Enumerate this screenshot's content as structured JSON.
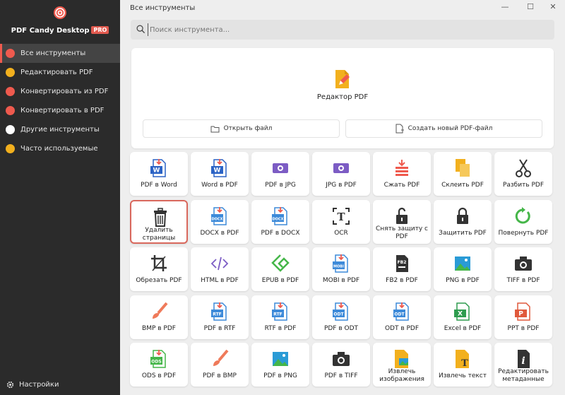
{
  "app": {
    "name": "PDF Candy Desktop",
    "badge": "PRO"
  },
  "window": {
    "title": "Все инструменты",
    "minimize": "—",
    "maximize": "☐",
    "close": "✕"
  },
  "search": {
    "placeholder": "Поиск инструмента..."
  },
  "sidebar": {
    "items": [
      {
        "label": "Все инструменты",
        "color": "#ef5a4e",
        "active": true
      },
      {
        "label": "Редактировать PDF",
        "color": "#f2b01e"
      },
      {
        "label": "Конвертировать из PDF",
        "color": "#ef5a4e"
      },
      {
        "label": "Конвертировать в PDF",
        "color": "#ef5a4e"
      },
      {
        "label": "Другие инструменты",
        "color": "#ffffff"
      },
      {
        "label": "Часто используемые",
        "color": "#f2b01e"
      }
    ],
    "settings": "Настройки"
  },
  "hero": {
    "title": "Редактор PDF",
    "open_file": "Открыть файл",
    "create_new": "Создать новый PDF-файл"
  },
  "tools": [
    {
      "label": "PDF в Word",
      "icon": "word-icon",
      "color": "#2b63c5",
      "tag": "W"
    },
    {
      "label": "Word в PDF",
      "icon": "word-icon",
      "color": "#2b63c5",
      "tag": "W"
    },
    {
      "label": "PDF в JPG",
      "icon": "image-icon",
      "color": "#7c5cc4",
      "tag": ""
    },
    {
      "label": "JPG в PDF",
      "icon": "image-icon",
      "color": "#7c5cc4",
      "tag": ""
    },
    {
      "label": "Сжать PDF",
      "icon": "compress-icon",
      "color": "#ef5a4e",
      "tag": ""
    },
    {
      "label": "Склеить PDF",
      "icon": "merge-icon",
      "color": "#f2b01e",
      "tag": ""
    },
    {
      "label": "Разбить PDF",
      "icon": "scissors-icon",
      "color": "#333333",
      "tag": ""
    },
    {
      "label": "Удалить страницы",
      "icon": "trash-icon",
      "color": "#333333",
      "tag": "",
      "selected": true
    },
    {
      "label": "DOCX в PDF",
      "icon": "docx-icon",
      "color": "#3d8ad9",
      "tag": "DOCX"
    },
    {
      "label": "PDF в DOCX",
      "icon": "docx-icon",
      "color": "#3d8ad9",
      "tag": "DOCX"
    },
    {
      "label": "OCR",
      "icon": "ocr-icon",
      "color": "#333333",
      "tag": "T"
    },
    {
      "label": "Снять защиту с PDF",
      "icon": "unlock-icon",
      "color": "#333333",
      "tag": ""
    },
    {
      "label": "Защитить PDF",
      "icon": "lock-icon",
      "color": "#333333",
      "tag": ""
    },
    {
      "label": "Повернуть PDF",
      "icon": "rotate-icon",
      "color": "#45b649",
      "tag": ""
    },
    {
      "label": "Обрезать PDF",
      "icon": "crop-icon",
      "color": "#333333",
      "tag": ""
    },
    {
      "label": "HTML в PDF",
      "icon": "code-icon",
      "color": "#7c5cc4",
      "tag": "</>"
    },
    {
      "label": "EPUB в PDF",
      "icon": "epub-icon",
      "color": "#45b649",
      "tag": ""
    },
    {
      "label": "MOBI в PDF",
      "icon": "mobi-icon",
      "color": "#3d8ad9",
      "tag": "MOBI"
    },
    {
      "label": "FB2 в PDF",
      "icon": "fb2-icon",
      "color": "#333333",
      "tag": "FB2"
    },
    {
      "label": "PNG в PDF",
      "icon": "picture-icon",
      "color": "#2a9bd6",
      "tag": ""
    },
    {
      "label": "TIFF в PDF",
      "icon": "camera-icon",
      "color": "#333333",
      "tag": ""
    },
    {
      "label": "BMP в PDF",
      "icon": "brush-icon",
      "color": "#ef7a5a",
      "tag": ""
    },
    {
      "label": "PDF в RTF",
      "icon": "rtf-icon",
      "color": "#3d8ad9",
      "tag": "RTF"
    },
    {
      "label": "RTF в PDF",
      "icon": "rtf-icon",
      "color": "#3d8ad9",
      "tag": "RTF"
    },
    {
      "label": "PDF в ODT",
      "icon": "odt-icon",
      "color": "#3d8ad9",
      "tag": "ODT"
    },
    {
      "label": "ODT в PDF",
      "icon": "odt-icon",
      "color": "#3d8ad9",
      "tag": "ODT"
    },
    {
      "label": "Excel в PDF",
      "icon": "excel-icon",
      "color": "#2e9c4e",
      "tag": "X"
    },
    {
      "label": "PPT в PDF",
      "icon": "ppt-icon",
      "color": "#e0593c",
      "tag": "P"
    },
    {
      "label": "ODS в PDF",
      "icon": "ods-icon",
      "color": "#45b649",
      "tag": "ODS"
    },
    {
      "label": "PDF в BMP",
      "icon": "brush-icon",
      "color": "#ef7a5a",
      "tag": ""
    },
    {
      "label": "PDF в PNG",
      "icon": "picture-icon",
      "color": "#2a9bd6",
      "tag": ""
    },
    {
      "label": "PDF в TIFF",
      "icon": "camera-icon",
      "color": "#333333",
      "tag": ""
    },
    {
      "label": "Извлечь изображения",
      "icon": "extract-images-icon",
      "color": "#f2b01e",
      "tag": ""
    },
    {
      "label": "Извлечь текст",
      "icon": "extract-text-icon",
      "color": "#f2b01e",
      "tag": "T"
    },
    {
      "label": "Редактировать метаданные",
      "icon": "info-icon",
      "color": "#333333",
      "tag": "i"
    }
  ]
}
